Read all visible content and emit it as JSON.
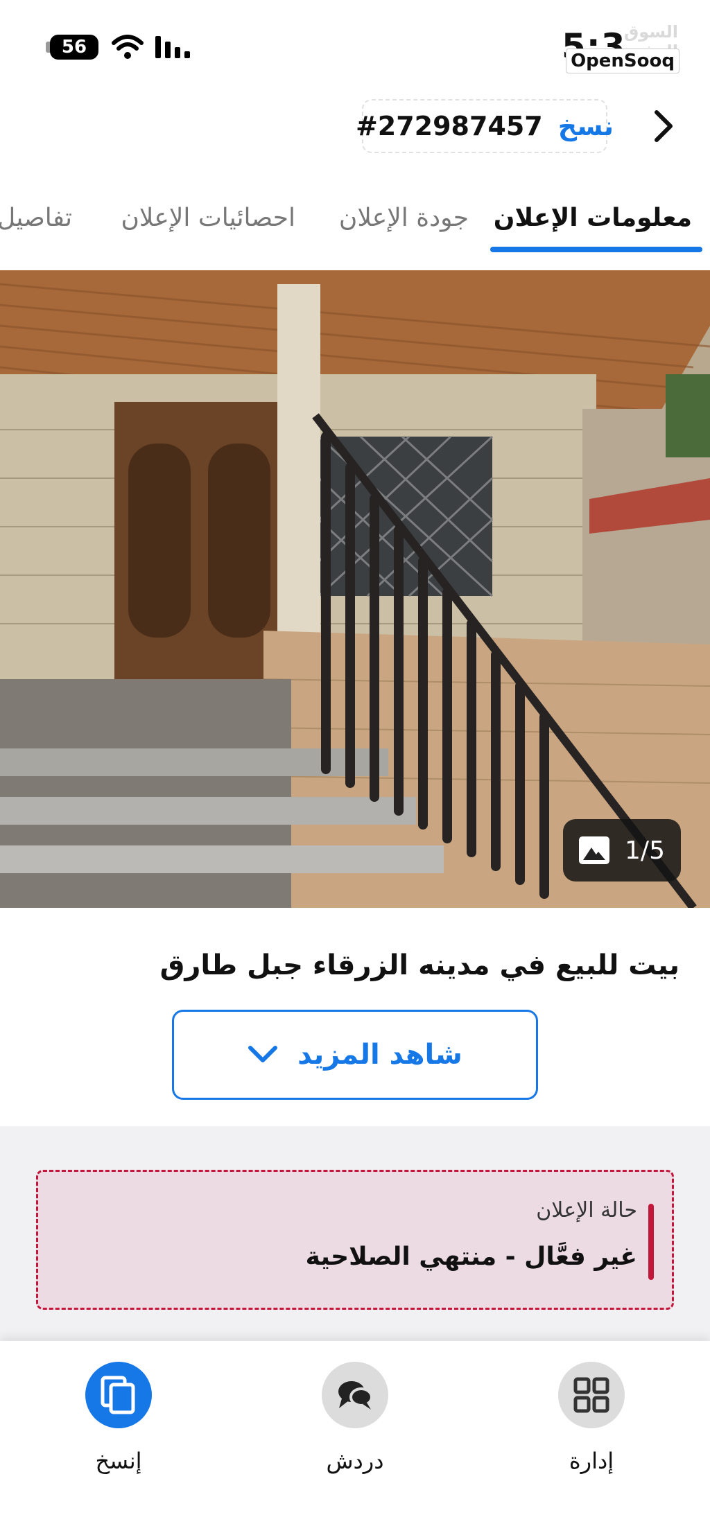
{
  "status_bar": {
    "battery": "56",
    "time": "5:3",
    "logo_ar": "السوق المفتوح",
    "logo_en": "OpenSooq"
  },
  "header": {
    "ad_id": "#272987457",
    "copy_label": "نسخ"
  },
  "tabs": [
    {
      "label": "معلومات الإعلان",
      "active": true
    },
    {
      "label": "جودة الإعلان",
      "active": false
    },
    {
      "label": "احصائيات الإعلان",
      "active": false
    },
    {
      "label": "تفاصيل",
      "active": false
    }
  ],
  "gallery": {
    "counter": "1/5"
  },
  "ad": {
    "title": "بيت للبيع في مدينه الزرقاء جبل طارق",
    "see_more_label": "شاهد المزيد"
  },
  "status": {
    "heading": "حالة الإعلان",
    "value": "غير فعَّال - منتهي الصلاحية"
  },
  "bottom_actions": [
    {
      "label": "إدارة",
      "icon": "grid-icon"
    },
    {
      "label": "دردش",
      "icon": "chat-icon"
    },
    {
      "label": "إنسخ",
      "icon": "copy-icon"
    }
  ],
  "colors": {
    "accent": "#1677e6",
    "status_red": "#c4163b",
    "status_bg": "#ecdbe2"
  }
}
